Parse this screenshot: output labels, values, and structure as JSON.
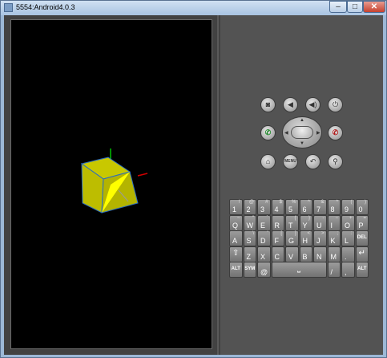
{
  "window": {
    "title": "5554:Android4.0.3",
    "min_label": "–",
    "max_label": "□",
    "close_label": "✕"
  },
  "scene": {
    "background": "#000000",
    "cube": {
      "face_color": "#c8c800",
      "highlight_color": "#ffff00",
      "edge_color": "#2a6cc4"
    },
    "axes": {
      "x_color": "#d00000",
      "y_color": "#00c000",
      "z_color": "#9a9a9a"
    }
  },
  "controls": {
    "top_row": [
      {
        "name": "camera-button",
        "icon": "camera-icon",
        "glyph": "◙"
      },
      {
        "name": "volume-down-button",
        "icon": "volume-down-icon",
        "glyph": "◀"
      },
      {
        "name": "volume-up-button",
        "icon": "volume-up-icon",
        "glyph": "◀)"
      },
      {
        "name": "power-button",
        "icon": "power-icon",
        "glyph": "⏻"
      }
    ],
    "call_glyph": "✆",
    "end_glyph": "✆",
    "dpad_arrows": {
      "up": "▲",
      "down": "▼",
      "left": "◀",
      "right": "▶"
    },
    "bottom_row": [
      {
        "name": "home-button",
        "icon": "home-icon",
        "glyph": "⌂"
      },
      {
        "name": "menu-button",
        "icon": "menu-icon",
        "glyph": "MENU"
      },
      {
        "name": "back-button",
        "icon": "back-icon",
        "glyph": "↶"
      },
      {
        "name": "search-button",
        "icon": "search-icon",
        "glyph": "⚲"
      }
    ]
  },
  "keyboard": {
    "rows": [
      [
        {
          "m": "1",
          "a": "!"
        },
        {
          "m": "2",
          "a": "@"
        },
        {
          "m": "3",
          "a": "#"
        },
        {
          "m": "4",
          "a": "$"
        },
        {
          "m": "5",
          "a": "%"
        },
        {
          "m": "6",
          "a": "^"
        },
        {
          "m": "7",
          "a": "&"
        },
        {
          "m": "8",
          "a": "*"
        },
        {
          "m": "9",
          "a": "("
        },
        {
          "m": "0",
          "a": ")"
        }
      ],
      [
        {
          "m": "Q",
          "a": "~"
        },
        {
          "m": "W",
          "a": "\""
        },
        {
          "m": "E",
          "a": "´"
        },
        {
          "m": "R",
          "a": ""
        },
        {
          "m": "T",
          "a": "{"
        },
        {
          "m": "Y",
          "a": "}"
        },
        {
          "m": "U",
          "a": "-"
        },
        {
          "m": "I",
          "a": "−"
        },
        {
          "m": "O",
          "a": "+"
        },
        {
          "m": "P",
          "a": "="
        }
      ],
      [
        {
          "m": "A",
          "a": ""
        },
        {
          "m": "S",
          "a": "\\"
        },
        {
          "m": "D",
          "a": "'"
        },
        {
          "m": "F",
          "a": "["
        },
        {
          "m": "G",
          "a": "]"
        },
        {
          "m": "H",
          "a": "<"
        },
        {
          "m": "J",
          "a": ">"
        },
        {
          "m": "K",
          "a": ";"
        },
        {
          "m": "L",
          "a": ":"
        },
        {
          "m": "DEL",
          "a": ""
        }
      ],
      [
        {
          "m": "⇧",
          "a": ""
        },
        {
          "m": "Z",
          "a": ""
        },
        {
          "m": "X",
          "a": ""
        },
        {
          "m": "C",
          "a": ""
        },
        {
          "m": "V",
          "a": ""
        },
        {
          "m": "B",
          "a": ""
        },
        {
          "m": "N",
          "a": ""
        },
        {
          "m": "M",
          "a": ""
        },
        {
          "m": ".",
          "a": ""
        },
        {
          "m": "↵",
          "a": ""
        }
      ]
    ],
    "bottom": {
      "alt": "ALT",
      "sym": "SYM",
      "at": "@",
      "space": "⎵",
      "slash": "/",
      "comma": ",",
      "alt2": "ALT"
    }
  }
}
